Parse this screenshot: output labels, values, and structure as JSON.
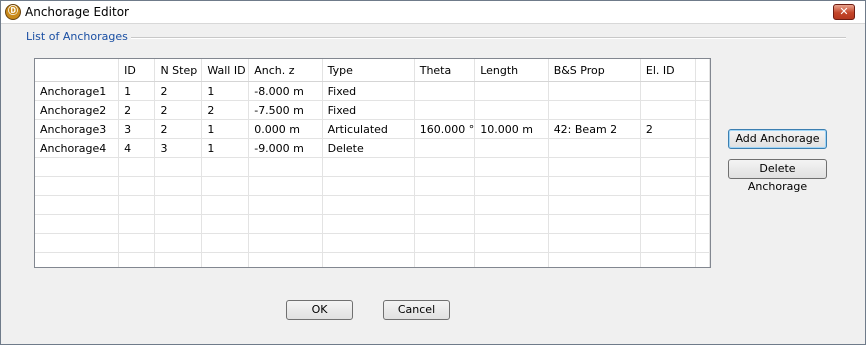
{
  "window": {
    "title": "Anchorage Editor",
    "close_glyph": "✕",
    "app_icon": "app-icon"
  },
  "group": {
    "label": "List of Anchorages"
  },
  "table": {
    "columns": [
      "",
      "ID",
      "N Step",
      "Wall ID",
      "Anch. z",
      "Type",
      "Theta",
      "Length",
      "B&S Prop",
      "El. ID",
      ""
    ],
    "rows": [
      [
        "Anchorage1",
        "1",
        "2",
        "1",
        "-8.000 m",
        "Fixed",
        "",
        "",
        "",
        "",
        ""
      ],
      [
        "Anchorage2",
        "2",
        "2",
        "2",
        "-7.500 m",
        "Fixed",
        "",
        "",
        "",
        "",
        ""
      ],
      [
        "Anchorage3",
        "3",
        "2",
        "1",
        "0.000 m",
        "Articulated",
        "160.000 °",
        "10.000 m",
        "42: Beam 2",
        "2",
        ""
      ],
      [
        "Anchorage4",
        "4",
        "3",
        "1",
        "-9.000 m",
        "Delete",
        "",
        "",
        "",
        "",
        ""
      ]
    ],
    "empty_rows": 7
  },
  "buttons": {
    "add": "Add Anchorage",
    "delete": "Delete Anchorage",
    "ok": "OK",
    "cancel": "Cancel"
  }
}
